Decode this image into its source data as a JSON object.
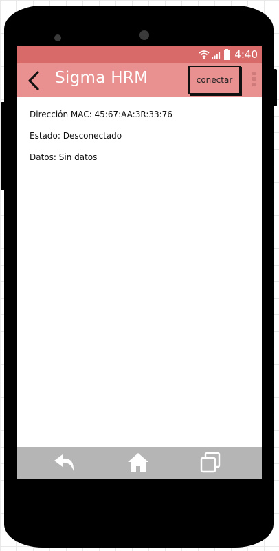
{
  "status_bar": {
    "time": "4:40",
    "icons": [
      "wifi-icon",
      "signal-icon",
      "battery-icon"
    ]
  },
  "app_bar": {
    "title": "Sigma HRM",
    "back_icon": "chevron-left-icon",
    "connect_label": "conectar",
    "overflow_icon": "overflow-menu-icon"
  },
  "content": {
    "mac": "Dirección MAC: 45:67:AA:3R:33:76",
    "status": "Estado: Desconectado",
    "data": "Datos: Sin datos"
  },
  "nav_bar": {
    "icons": [
      "back-arrow-icon",
      "home-icon",
      "recents-icon"
    ]
  },
  "colors": {
    "status_bar": "#d96a6a",
    "app_bar": "#e99191",
    "nav_bar": "#b5b5b5",
    "phone_body": "#000000"
  }
}
